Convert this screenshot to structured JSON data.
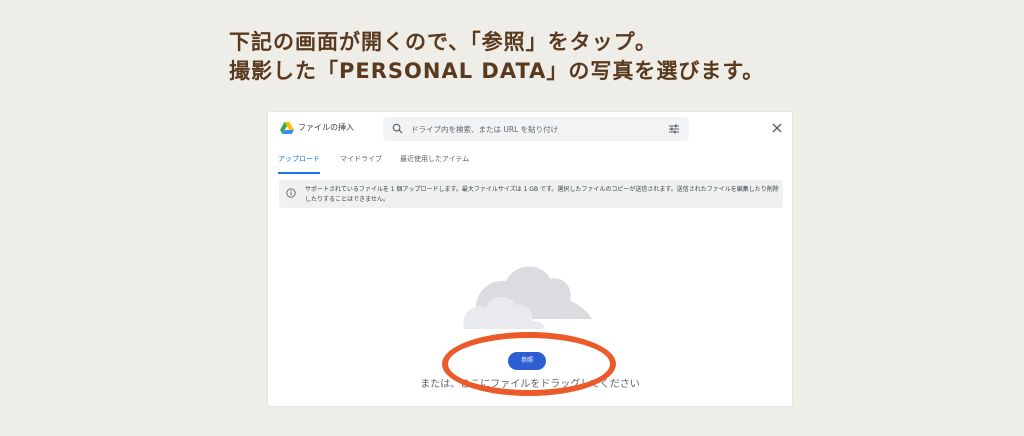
{
  "instruction": {
    "line1_pre": "下記の画面が開くので、「",
    "line1_highlight": "参照",
    "line1_post": "」をタップ。",
    "line2_pre": "撮影した「",
    "line2_highlight": "PERSONAL DATA",
    "line2_post": "」の写真を選びます。"
  },
  "dialog": {
    "title": "ファイルの挿入",
    "search_placeholder": "ドライブ内を検索、または URL を貼り付け",
    "tabs": [
      {
        "label": "アップロード",
        "active": true
      },
      {
        "label": "マイドライブ",
        "active": false
      },
      {
        "label": "最近使用したアイテム",
        "active": false
      }
    ],
    "info_text": "サポートされているファイルを 1 個アップロードします。最大ファイルサイズは 1 GB です。選択したファイルのコピーが送信されます。送信されたファイルを編集したり削除したりすることはできません。",
    "browse_label": "参照",
    "drop_text": "または、ここにファイルをドラッグしてください"
  },
  "colors": {
    "background": "#efede8",
    "instruction_text": "#5a3a1e",
    "accent_blue": "#1a73e8",
    "button_blue": "#2d5fd3",
    "highlight_orange": "#ec5a2a"
  },
  "icons": [
    "google-drive-logo",
    "search-icon",
    "tune-icon",
    "close-icon",
    "info-icon",
    "cloud-illustration"
  ]
}
